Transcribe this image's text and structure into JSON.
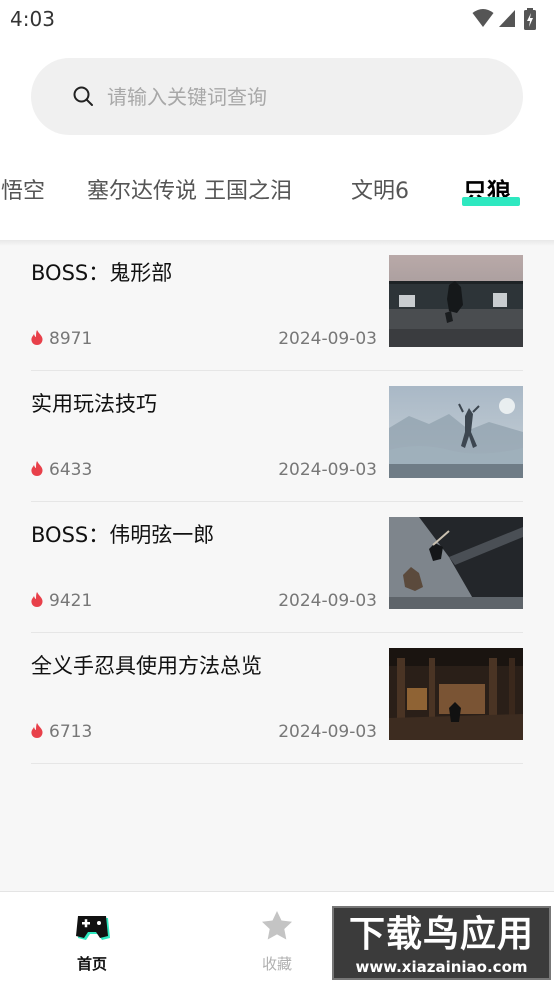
{
  "status_bar": {
    "time": "4:03",
    "icons": [
      "wifi-icon",
      "signal-icon",
      "battery-icon"
    ]
  },
  "search": {
    "placeholder": "请输入关键词查询",
    "value": "",
    "icon": "search-icon"
  },
  "tabs": [
    {
      "label": "悟空",
      "active": false
    },
    {
      "label": "塞尔达传说 王国之泪",
      "active": false
    },
    {
      "label": "文明6",
      "active": false
    },
    {
      "label": "只狼",
      "active": true
    }
  ],
  "articles": [
    {
      "title": "BOSS：鬼形部",
      "views": "8971",
      "date": "2024-09-03",
      "thumbnail": "sekiro-boss-gyoubu"
    },
    {
      "title": "实用玩法技巧",
      "views": "6433",
      "date": "2024-09-03",
      "thumbnail": "sekiro-misty-valley"
    },
    {
      "title": "BOSS：伟明弦一郎",
      "views": "9421",
      "date": "2024-09-03",
      "thumbnail": "sekiro-boss-genichiro"
    },
    {
      "title": "全义手忍具使用方法总览",
      "views": "6713",
      "date": "2024-09-03",
      "thumbnail": "sekiro-dilapidated-temple"
    }
  ],
  "bottom_nav": {
    "home": {
      "label": "首页",
      "icon": "gamepad-icon",
      "active": true
    },
    "favorites": {
      "label": "收藏",
      "icon": "star-icon",
      "active": false
    }
  },
  "watermark": {
    "line1": "下载鸟应用",
    "line2": "www.xiazainiao.com"
  },
  "colors": {
    "accent": "#2ee8c0",
    "fire": "#e8404a",
    "background": "#f7f7f7",
    "search_bg": "#f0f0f0"
  }
}
